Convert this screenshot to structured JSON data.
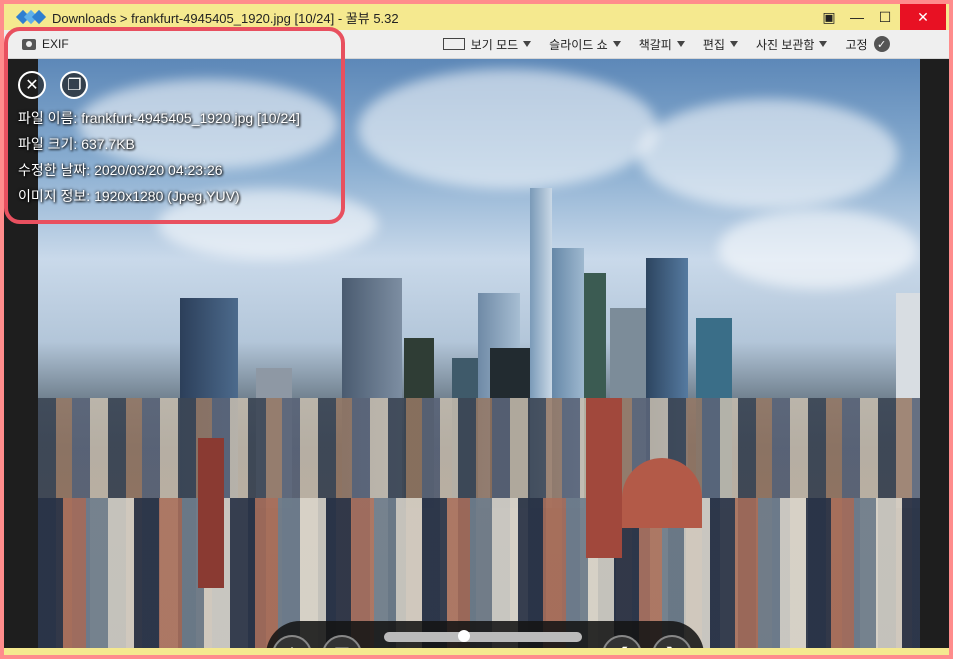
{
  "titlebar": {
    "title": "Downloads  >  frankfurt-4945405_1920.jpg  [10/24]  -  꿀뷰 5.32",
    "buttons": [
      "fullscreen-icon",
      "minimize-icon",
      "maximize-icon",
      "close-icon"
    ]
  },
  "toolbar": {
    "exif_label": "EXIF",
    "view_mode": "보기 모드",
    "slideshow": "슬라이드 쇼",
    "bookmark": "책갈피",
    "edit": "편집",
    "photo_storage": "사진 보관함",
    "pin": "고정"
  },
  "exif": {
    "file_name": "파일 이름: frankfurt-4945405_1920.jpg [10/24]",
    "file_size": "파일 크기: 637.7KB",
    "modified_date": "수정한 날짜: 2020/03/20 04:23:26",
    "image_info": "이미지 정보: 1920x1280 (Jpeg,YUV)"
  },
  "controls": {
    "plus": "+",
    "minus": "−",
    "pin_label": "고정",
    "slider_position_fraction": 0.4
  },
  "colors": {
    "window_border": "#ff8c8c",
    "titlebar_bg": "#f5e98f",
    "highlight": "#e8505f",
    "close_red": "#e81123"
  }
}
